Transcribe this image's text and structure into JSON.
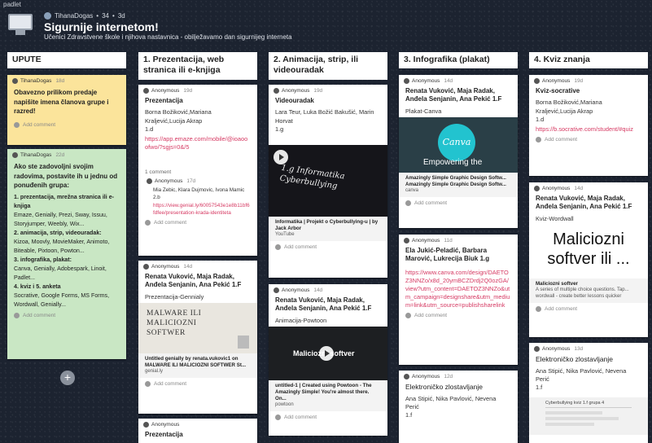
{
  "app": {
    "brand": "padlet"
  },
  "header": {
    "author": "TihanaDogas",
    "meta_count": "34",
    "meta_time": "3d",
    "title": "Sigurnije internetom!",
    "subtitle": "Učenici Zdravstvene škole i njihova nastavnica - obilježavamo dan sigurnijeg interneta"
  },
  "columns": [
    {
      "title": "UPUTE",
      "cards": [
        {
          "author": "TihanaDogas",
          "time": "18d",
          "text": "Obavezno prilikom predaje napišite imena članova grupe i razred!",
          "add_comment": "Add comment"
        },
        {
          "author": "TihanaDogas",
          "time": "22d",
          "text": "Ako ste zadovoljni svojim radovima, postavite ih u jednu od ponuđenih grupa:",
          "items": [
            {
              "head": "1. prezentacija, mrežna stranica ili e-knjiga",
              "body": "Emaze, Genially, Prezi, Sway, Issuu, Storyjumper, Weebly, Wix..."
            },
            {
              "head": "2. animacija, strip, videouradak:",
              "body": "Kizoa, Moovly, MovieMaker, Animoto, Biteable, Pixtoon, Powton..."
            },
            {
              "head": "3. infografika, plakat:",
              "body": "Canva, Genially, Adobespark, Linoit, Padlet..."
            },
            {
              "head": "4. kviz i 5. anketa",
              "body": "Socrative, Google Forms, MS Forms, Wordwall, Genially..."
            }
          ],
          "add_comment": "Add comment"
        }
      ]
    },
    {
      "title": "1. Prezentacija, web stranica ili e-knjiga",
      "cards": [
        {
          "author": "Anonymous",
          "time": "19d",
          "title": "Prezentacija",
          "body": "Borna Božiković,Mariana Kraljević,Lucija Akrap\n1.d",
          "link": "https://app.emaze.com/mobile/@ioaooofwo/?sgjs=0&/5",
          "comments": "1 comment",
          "comment_author": "Anonymous",
          "comment_time": "17d",
          "comment_text": "Mia Zebic, Klara Dujmovic, Ivona Mamic 2.b",
          "comment_link": "https://view.genial.ly/60057543e1e8b11bf6fdfee/presentation-krada-identiteta",
          "add_comment": "Add comment"
        },
        {
          "author": "Anonymous",
          "time": "14d",
          "title": "Renata Vuković, Maja Radak, Anđela Senjanin, Ana Pekić 1.F",
          "body": "Prezentacija-Gennialy",
          "thumb_text": "MALWARE ILI MALICIOZNI SOFTWER",
          "attach_title": "Untitled genially by renata.vukovic1 on MALWARE ILI MALICIOZNI SOFTWER St...",
          "attach_source": "genial.ly",
          "add_comment": "Add comment"
        },
        {
          "author": "Anonymous",
          "time": "",
          "title": "Prezentacija"
        }
      ]
    },
    {
      "title": "2. Animacija, strip, ili videouradak",
      "cards": [
        {
          "author": "Anonymous",
          "time": "19d",
          "title": "Videouradak",
          "body": "Lara Teur, Luka Božić Bakušić, Marin Horvat\n1.g",
          "thumb_text": "1.g Informatika Cyberbullying",
          "attach_title": "Informatika | Projekt o Cyberbullying-u | by Jack Arbor",
          "attach_source": "YouTube",
          "add_comment": "Add comment"
        },
        {
          "author": "Anonymous",
          "time": "14d",
          "title": "Renata Vuković, Maja Radak, Anđela Senjanin, Ana Pekić 1.F",
          "body": "Animacija-Powtoon",
          "thumb_text": "Maliciozni softver",
          "attach_title": "untitled-1 | Created using Powtoon - The Amazingly Simple! You're almost there. On...",
          "attach_source": "powtoon",
          "add_comment": "Add comment"
        }
      ]
    },
    {
      "title": "3. Infografika (plakat)",
      "cards": [
        {
          "author": "Anonymous",
          "time": "14d",
          "title": "Renata Vuković, Maja Radak, Anđela Senjanin, Ana Pekić 1.F",
          "body": "Plakat-Canva",
          "thumb_text": "Canva",
          "thumb_caption": "Empowering the",
          "attach_title": "Amazingly Simple Graphic Design Softw... Amazingly Simple Graphic Design Softw...",
          "attach_source": "canva",
          "add_comment": "Add comment"
        },
        {
          "author": "Anonymous",
          "time": "11d",
          "title": "Ela Jukić-Peladić, Barbara Marović, Lukrecija Biuk 1.g",
          "link": "https://www.canva.com/design/DAETOZ3NNZo/x8d_20ymBCZDrdj2Q0ozGA/view?utm_content=DAETOZ3NNZo&utm_campaign=designshare&utm_medium=link&utm_source=publishsharelink",
          "add_comment": "Add comment"
        },
        {
          "author": "Anonymous",
          "time": "12d",
          "title": "Elektroničko zlostavljanje",
          "body": "Ana Stipić, Nika Pavlović, Nevena Perić\n1.f"
        }
      ]
    },
    {
      "title": "4. Kviz znanja",
      "cards": [
        {
          "author": "Anonymous",
          "time": "19d",
          "title": "Kviz-socrative",
          "body": "Borna Božiković,Mariana Kraljević,Lucija Akrap\n1.d",
          "link": "https://b.socrative.com/student/#quiz",
          "add_comment": "Add comment"
        },
        {
          "author": "Anonymous",
          "time": "14d",
          "title": "Renata Vuković, Maja Radak, Anđela Senjanin, Ana Pekić 1.F",
          "body": "Kviz-Wordwall",
          "thumb_text": "Maliciozni softver ili ...",
          "attach_title": "Maliciozni softver",
          "attach_desc": "A series of multiple choice questions. Tap... wordwall - create better lessons quicker",
          "add_comment": "Add comment"
        },
        {
          "author": "Anonymous",
          "time": "13d",
          "title": "Elektroničko zlostavljanje",
          "body": "Ana Stipić, Nika Pavlović, Nevena Perić\n1.f",
          "thumb_caption": "Cyberbullying kviz 1.f grupa 4"
        }
      ]
    }
  ],
  "add_icon": "plus"
}
